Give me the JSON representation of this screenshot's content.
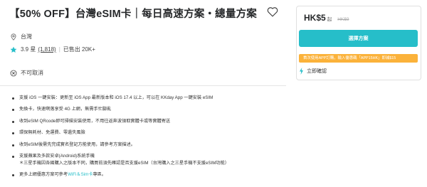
{
  "product": {
    "title": "【50% OFF】台灣eSIM卡｜每日高速方案・總量方案",
    "location": "台灣",
    "rating": "3.9 星",
    "rating_count": "(1,818)",
    "sold": "已售出 20K+",
    "cancellation": "不可取消"
  },
  "features": [
    {
      "text": "支援 iOS 一鍵安裝：更新至 iOS App 最新版本和 iOS 17.4 以上，可以在 KKday App 一鍵安裝 eSIM"
    },
    {
      "text": "免換卡，快速啊落享受 4G 上網，無需手忙腳亂"
    },
    {
      "text": "收到eSIM QRcode即可掃描安裝使用，不用往返奔波領取實體卡或等實體寄送"
    },
    {
      "text": "環保無耗材、免運費、零遺失風險"
    },
    {
      "text": "收到eSIM後需先完成實名登記方能使用，請參考方案描述。"
    },
    {
      "text": "支援蘋果及多款安卓(Android)系統手機",
      "sub": "＊三星手機因各國購入之版本不同，購買前須先確認是否支援eSIM（台灣購入之三星手機不支援eSIM功能）"
    },
    {
      "text": "更多上網優惠方案可參考",
      "link": "WiFi＆Sim卡",
      "suffix": "專區。"
    }
  ],
  "booking": {
    "price": "HK$5",
    "price_suffix": "起",
    "original_price": "HK$9",
    "select_button": "選擇方案",
    "promo": "首次使用APP訂購，輸入優惠碼「APP15HK」即減$15",
    "confirm": "立即確認"
  },
  "colors": {
    "accent": "#26bec9",
    "promo": "#fbb23a",
    "star": "#26bec9"
  },
  "icons": {
    "heart": "heart-outline-icon",
    "location": "location-pin-icon",
    "star": "star-icon",
    "cancel": "cancel-circle-icon",
    "bolt": "lightning-bolt-icon"
  }
}
